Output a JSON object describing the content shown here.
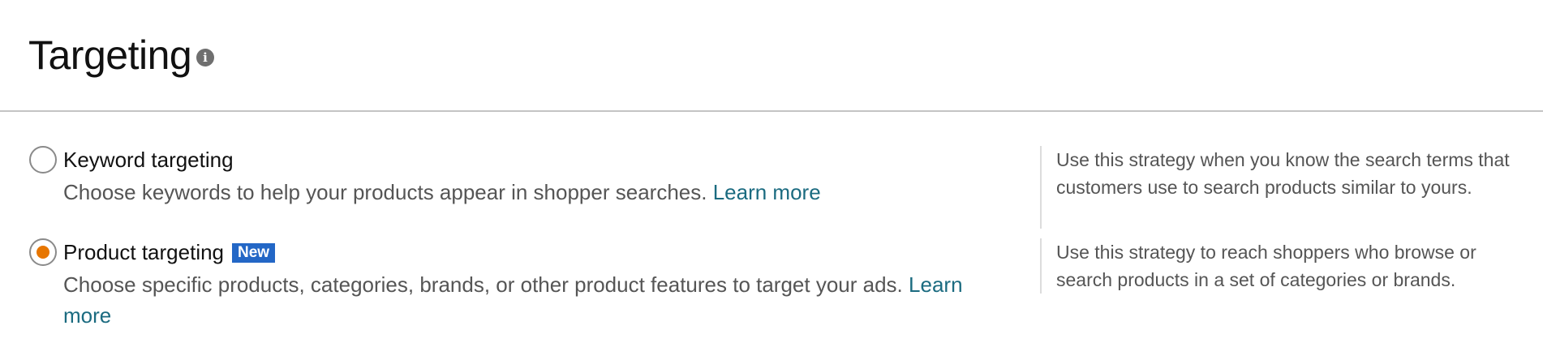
{
  "header": {
    "title": "Targeting",
    "info_icon": "info-icon"
  },
  "options": [
    {
      "label": "Keyword targeting",
      "selected": false,
      "description": "Choose keywords to help your products appear in shopper searches.",
      "link": "Learn more",
      "help": "Use this strategy when you know the search terms that customers use to search products similar to yours."
    },
    {
      "label": "Product targeting",
      "badge": "New",
      "selected": true,
      "description": "Choose specific products, categories, brands, or other product features to target your ads.",
      "link": "Learn more",
      "help": "Use this strategy to reach shoppers who browse or search products in a set of categories or brands."
    }
  ],
  "colors": {
    "accent_radio": "#e77600",
    "badge_bg": "#2367c6",
    "link": "#1b6b80",
    "divider": "#c4c4c4"
  }
}
